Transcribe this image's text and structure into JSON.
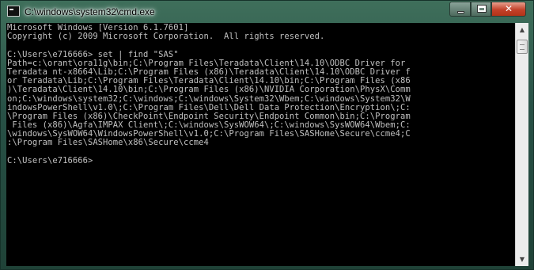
{
  "window": {
    "title": "C:\\windows\\system32\\cmd.exe",
    "icon": "console-icon",
    "controls": {
      "minimize": "",
      "maximize": "",
      "close": "✕"
    }
  },
  "console": {
    "lines": [
      "Microsoft Windows [Version 6.1.7601]",
      "Copyright (c) 2009 Microsoft Corporation.  All rights reserved.",
      "",
      "C:\\Users\\e716666> set | find \"SAS\"",
      "Path=c:\\orant\\ora11g\\bin;C:\\Program Files\\Teradata\\Client\\14.10\\ODBC Driver for",
      "Teradata nt-x8664\\Lib;C:\\Program Files (x86)\\Teradata\\Client\\14.10\\ODBC Driver f",
      "or Teradata\\Lib;C:\\Program Files\\Teradata\\Client\\14.10\\bin;C:\\Program Files (x86",
      ")\\Teradata\\Client\\14.10\\bin;C:\\Program Files (x86)\\NVIDIA Corporation\\PhysX\\Comm",
      "on;C:\\windows\\system32;C:\\windows;C:\\windows\\System32\\Wbem;C:\\windows\\System32\\W",
      "indowsPowerShell\\v1.0\\;C:\\Program Files\\Dell\\Dell Data Protection\\Encryption\\;C:",
      "\\Program Files (x86)\\CheckPoint\\Endpoint Security\\Endpoint Common\\bin;C:\\Program",
      " Files (x86)\\Agfa\\IMPAX Client\\;C:\\windows\\SysWOW64\\;C:\\windows\\SysWOW64\\Wbem;C:",
      "\\windows\\SysWOW64\\WindowsPowerShell\\v1.0;C:\\Program Files\\SASHome\\Secure\\ccme4;C",
      ":\\Program Files\\SASHome\\x86\\Secure\\ccme4",
      "",
      "C:\\Users\\e716666>"
    ]
  },
  "scrollbar": {
    "up": "▲",
    "down": "▼"
  },
  "colors": {
    "console_bg": "#000000",
    "console_fg": "#c0c0c0",
    "close_button": "#c3412a"
  }
}
